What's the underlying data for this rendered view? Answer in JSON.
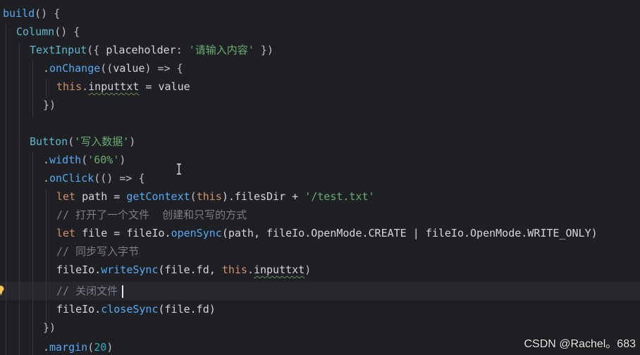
{
  "code": {
    "l1": {
      "fn": "build",
      "rest": "() {"
    },
    "l2": {
      "fn": "Column",
      "rest": "() {"
    },
    "l3": {
      "fn": "TextInput",
      "open": "({ ",
      "prop": "placeholder",
      "colon": ": ",
      "str": "'请输入内容'",
      "close": " })"
    },
    "l4": {
      "dot": ".",
      "fn": "onChange",
      "open": "((",
      "param": "value",
      "arrow": ") => {"
    },
    "l5": {
      "this": "this",
      "dot": ".",
      "prop": "inputtxt",
      "rest": " = value"
    },
    "l6": {
      "text": "})"
    },
    "l7": {
      "fn": "Button",
      "open": "(",
      "str": "'写入数据'",
      "close": ")"
    },
    "l8": {
      "dot": ".",
      "fn": "width",
      "open": "(",
      "str": "'60%'",
      "close": ")"
    },
    "l9": {
      "dot": ".",
      "fn": "onClick",
      "rest": "(() => {"
    },
    "l10": {
      "kw": "let",
      "a": " path = ",
      "fn": "getContext",
      "b": "(",
      "this": "this",
      "c": ").filesDir + ",
      "str": "'/test.txt'"
    },
    "l11": {
      "comment": "// 打开了一个文件  创建和只写的方式"
    },
    "l12": {
      "kw": "let",
      "a": " file = fileIo.",
      "fn": "openSync",
      "b": "(path, fileIo.OpenMode.CREATE | fileIo.OpenMode.WRITE_ONLY)"
    },
    "l13": {
      "comment": "// 同步写入字节"
    },
    "l14": {
      "a": "fileIo.",
      "fn": "writeSync",
      "b": "(file.fd, ",
      "this": "this",
      "dot": ".",
      "prop": "inputtxt",
      "c": ")"
    },
    "l15": {
      "comment": "// 关闭文件"
    },
    "l16": {
      "a": "fileIo.",
      "fn": "closeSync",
      "b": "(file.fd)"
    },
    "l17": {
      "text": "})"
    },
    "l18": {
      "dot": ".",
      "fn": "margin",
      "open": "(",
      "num": "20",
      "close": ")"
    }
  },
  "watermark": "CSDN @Rachel。683",
  "icons": {
    "bulb": "lightbulb-icon",
    "cursor": "text-cursor-icon"
  },
  "colors": {
    "background": "#1f2023",
    "function": "#56a8f5",
    "string": "#6aab73",
    "keyword": "#cf8e6d",
    "comment": "#7a7e85"
  }
}
